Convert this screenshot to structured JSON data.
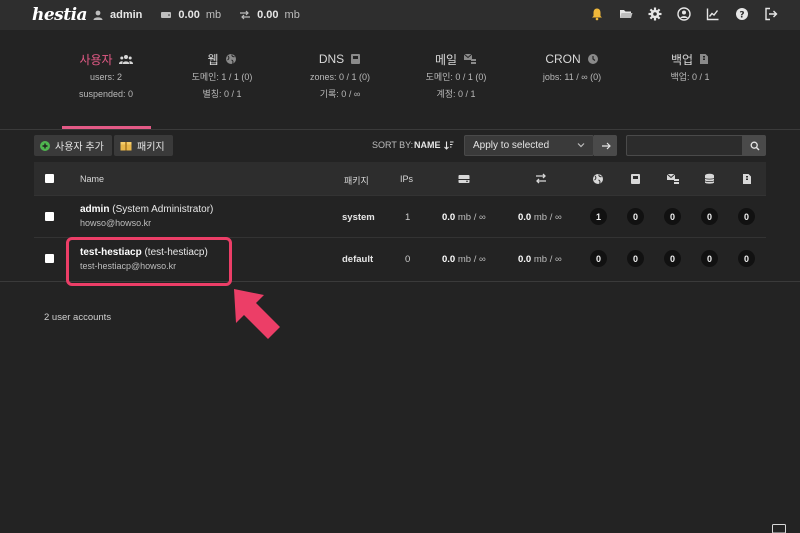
{
  "app": {
    "logo": "hestia"
  },
  "topbar": {
    "user": "admin",
    "disk_value": "0.00",
    "disk_unit": "mb",
    "bandwidth_value": "0.00",
    "bandwidth_unit": "mb",
    "icons": [
      "bell-icon",
      "folder-icon",
      "gear-icon",
      "user-circle-icon",
      "chart-line-icon",
      "help-icon",
      "logout-icon"
    ],
    "bell_color": "#f0b83a"
  },
  "tabs": [
    {
      "label": "사용자",
      "stats": [
        "users: 2",
        "suspended: 0"
      ],
      "active": true
    },
    {
      "label": "웹",
      "stats": [
        "도메인: 1 / 1 (0)",
        "별칭: 0 / 1"
      ]
    },
    {
      "label": "DNS",
      "stats": [
        "zones: 0 / 1 (0)",
        "기록: 0 / ∞"
      ]
    },
    {
      "label": "메일",
      "stats": [
        "도메인: 0 / 1 (0)",
        "계정: 0 / 1"
      ]
    },
    {
      "label": "CRON",
      "stats": [
        "jobs: 11 / ∞ (0)"
      ]
    },
    {
      "label": "백업",
      "stats": [
        "백업: 0 / 1"
      ]
    }
  ],
  "accent_color": "#e35a86",
  "toolbar": {
    "add_user": "사용자 추가",
    "packages": "패키지",
    "sort_label": "SORT BY:",
    "sort_value": "NAME",
    "bulk_select": "Apply to selected",
    "search_value": ""
  },
  "table": {
    "headers": {
      "name": "Name",
      "package": "패키지",
      "ips": "IPs"
    },
    "rows": [
      {
        "username": "admin",
        "fullname": "(System Administrator)",
        "email": "howso@howso.kr",
        "package": "system",
        "ips": "1",
        "disk": "0.0",
        "disk_unit": "mb / ∞",
        "bandwidth": "0.0",
        "bandwidth_unit": "mb / ∞",
        "web": "1",
        "dns": "0",
        "mail": "0",
        "db": "0",
        "backup": "0"
      },
      {
        "username": "test-hestiacp",
        "fullname": "(test-hestiacp)",
        "email": "test-hestiacp@howso.kr",
        "package": "default",
        "ips": "0",
        "disk": "0.0",
        "disk_unit": "mb / ∞",
        "bandwidth": "0.0",
        "bandwidth_unit": "mb / ∞",
        "web": "0",
        "dns": "0",
        "mail": "0",
        "db": "0",
        "backup": "0"
      }
    ]
  },
  "footer": {
    "count": "2 user accounts"
  },
  "annotation": {
    "highlight_color": "#ec3e67"
  }
}
